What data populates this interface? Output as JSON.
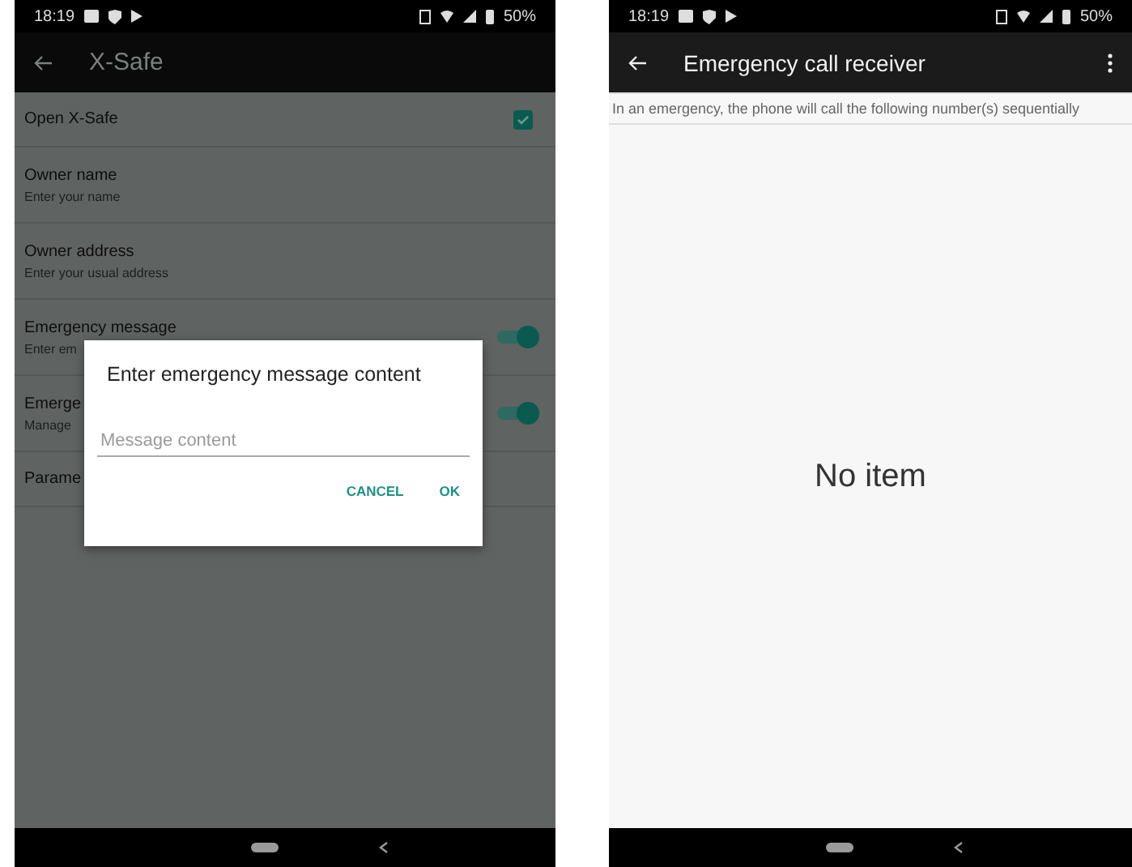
{
  "left_screen": {
    "status_bar": {
      "time": "18:19",
      "battery": "50%"
    },
    "app_bar": {
      "title": "X-Safe"
    },
    "settings": [
      {
        "kind": "checkbox",
        "title": "Open X-Safe",
        "checked": true
      },
      {
        "kind": "text",
        "title": "Owner name",
        "subtitle": "Enter your name"
      },
      {
        "kind": "text",
        "title": "Owner address",
        "subtitle": "Enter your usual address"
      },
      {
        "kind": "toggle",
        "title": "Emergency message",
        "subtitle": "Enter em",
        "on": true
      },
      {
        "kind": "toggle",
        "title": "Emerge",
        "subtitle": "Manage",
        "on": true
      },
      {
        "kind": "text",
        "title": "Parame"
      }
    ],
    "dialog": {
      "title": "Enter emergency message content",
      "placeholder": "Message content",
      "buttons": [
        "CANCEL",
        "OK"
      ]
    }
  },
  "right_screen": {
    "status_bar": {
      "time": "18:19",
      "battery": "50%"
    },
    "app_bar": {
      "title": "Emergency call receiver"
    },
    "banner": "In an emergency, the phone will call the following number(s) sequentially",
    "empty_text": "No item"
  }
}
